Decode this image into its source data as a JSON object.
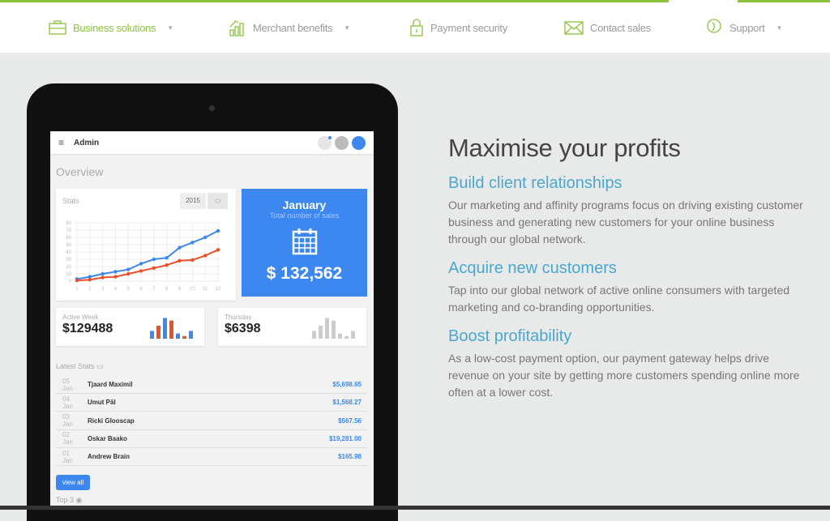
{
  "nav": {
    "items": [
      {
        "label": "Business solutions",
        "icon": "briefcase-icon",
        "dropdown": true,
        "active": true
      },
      {
        "label": "Merchant benefits",
        "icon": "bar-chart-icon",
        "dropdown": true
      },
      {
        "label": "Payment security",
        "icon": "lock-icon",
        "dropdown": false
      },
      {
        "label": "Contact sales",
        "icon": "envelope-icon",
        "dropdown": false
      },
      {
        "label": "Support",
        "icon": "headset-icon",
        "dropdown": true
      }
    ]
  },
  "colors": {
    "accent": "#8cc43f",
    "blue": "#3d87f0",
    "red": "#e8502a",
    "heading": "#4aa8d0"
  },
  "tablet": {
    "app_title": "Admin",
    "overview": "Overview",
    "stats": {
      "label": "Stats",
      "year": "2015"
    },
    "highlight": {
      "month": "January",
      "subtitle": "Total number of sales",
      "value": "$ 132,562"
    },
    "active_week": {
      "label": "Active Week",
      "value": "$129488",
      "bars": [
        3,
        5,
        8,
        7,
        2,
        1,
        3
      ],
      "bar_colors": [
        "b",
        "r",
        "b",
        "r",
        "b",
        "r",
        "b"
      ]
    },
    "thursday": {
      "label": "Thursday",
      "value": "$6398",
      "bars": [
        3,
        5,
        8,
        7,
        2,
        1,
        3
      ]
    },
    "latest_stats": {
      "label": "Latest Stats",
      "rows": [
        {
          "date": "05 Jan",
          "name": "Tjaard Maximil",
          "amount": "$5,698.65"
        },
        {
          "date": "04 Jan",
          "name": "Umut Pāl",
          "amount": "$1,568.27"
        },
        {
          "date": "03 Jan",
          "name": "Ricki Glooscap",
          "amount": "$567.56"
        },
        {
          "date": "02 Jan",
          "name": "Oskar Baako",
          "amount": "$19,281.00"
        },
        {
          "date": "01 Jan",
          "name": "Andrew Brain",
          "amount": "$165.98"
        }
      ]
    },
    "view_all": "view all",
    "top3": "Top 3"
  },
  "chart_data": {
    "type": "line",
    "x": [
      1,
      2,
      3,
      4,
      5,
      6,
      7,
      8,
      9,
      10,
      11,
      12
    ],
    "ylim": [
      0,
      80
    ],
    "yticks": [
      0,
      10,
      20,
      30,
      40,
      50,
      60,
      70,
      80
    ],
    "grid": true,
    "series": [
      {
        "color": "#3d87f0",
        "values": [
          3,
          6,
          10,
          13,
          16,
          24,
          30,
          32,
          46,
          53,
          60,
          69
        ]
      },
      {
        "color": "#e8502a",
        "values": [
          1,
          2,
          5,
          6,
          10,
          14,
          18,
          22,
          28,
          29,
          35,
          43
        ]
      }
    ]
  },
  "content": {
    "title": "Maximise your profits",
    "sections": [
      {
        "heading": "Build client relationships",
        "text": "Our marketing and affinity programs focus on driving existing customer business and generating new customers for your online business through our global network."
      },
      {
        "heading": "Acquire new customers",
        "text": "Tap into our global network of active online consumers with targeted marketing and co-branding opportunities."
      },
      {
        "heading": "Boost profitability",
        "text": "As a low-cost payment option, our payment gateway helps drive revenue on your site by getting more customers spending online more often at a lower cost."
      }
    ]
  }
}
